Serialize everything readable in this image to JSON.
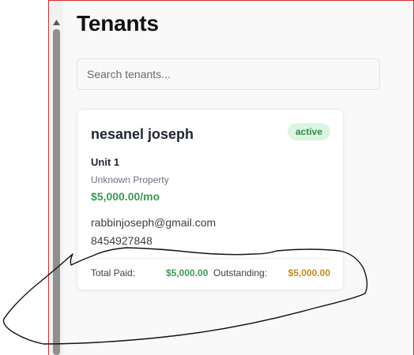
{
  "page": {
    "title": "Tenants"
  },
  "search": {
    "placeholder": "Search tenants..."
  },
  "tenants": [
    {
      "name": "nesanel joseph",
      "status": "active",
      "unit": "Unit 1",
      "property": "Unknown Property",
      "rent": "$5,000.00/mo",
      "email": "rabbinjoseph@gmail.com",
      "phone": "8454927848",
      "total_paid_label": "Total Paid:",
      "total_paid": "$5,000.00",
      "outstanding_label": "Outstanding:",
      "outstanding": "$5,000.00"
    }
  ],
  "colors": {
    "frame_border": "#d92b2b",
    "status_bg": "#dcf5e3",
    "status_text": "#2f8a4a",
    "paid": "#3c9a57",
    "outstanding": "#c8891c"
  },
  "icons": {
    "scroll_up": "triangle-up-icon"
  }
}
